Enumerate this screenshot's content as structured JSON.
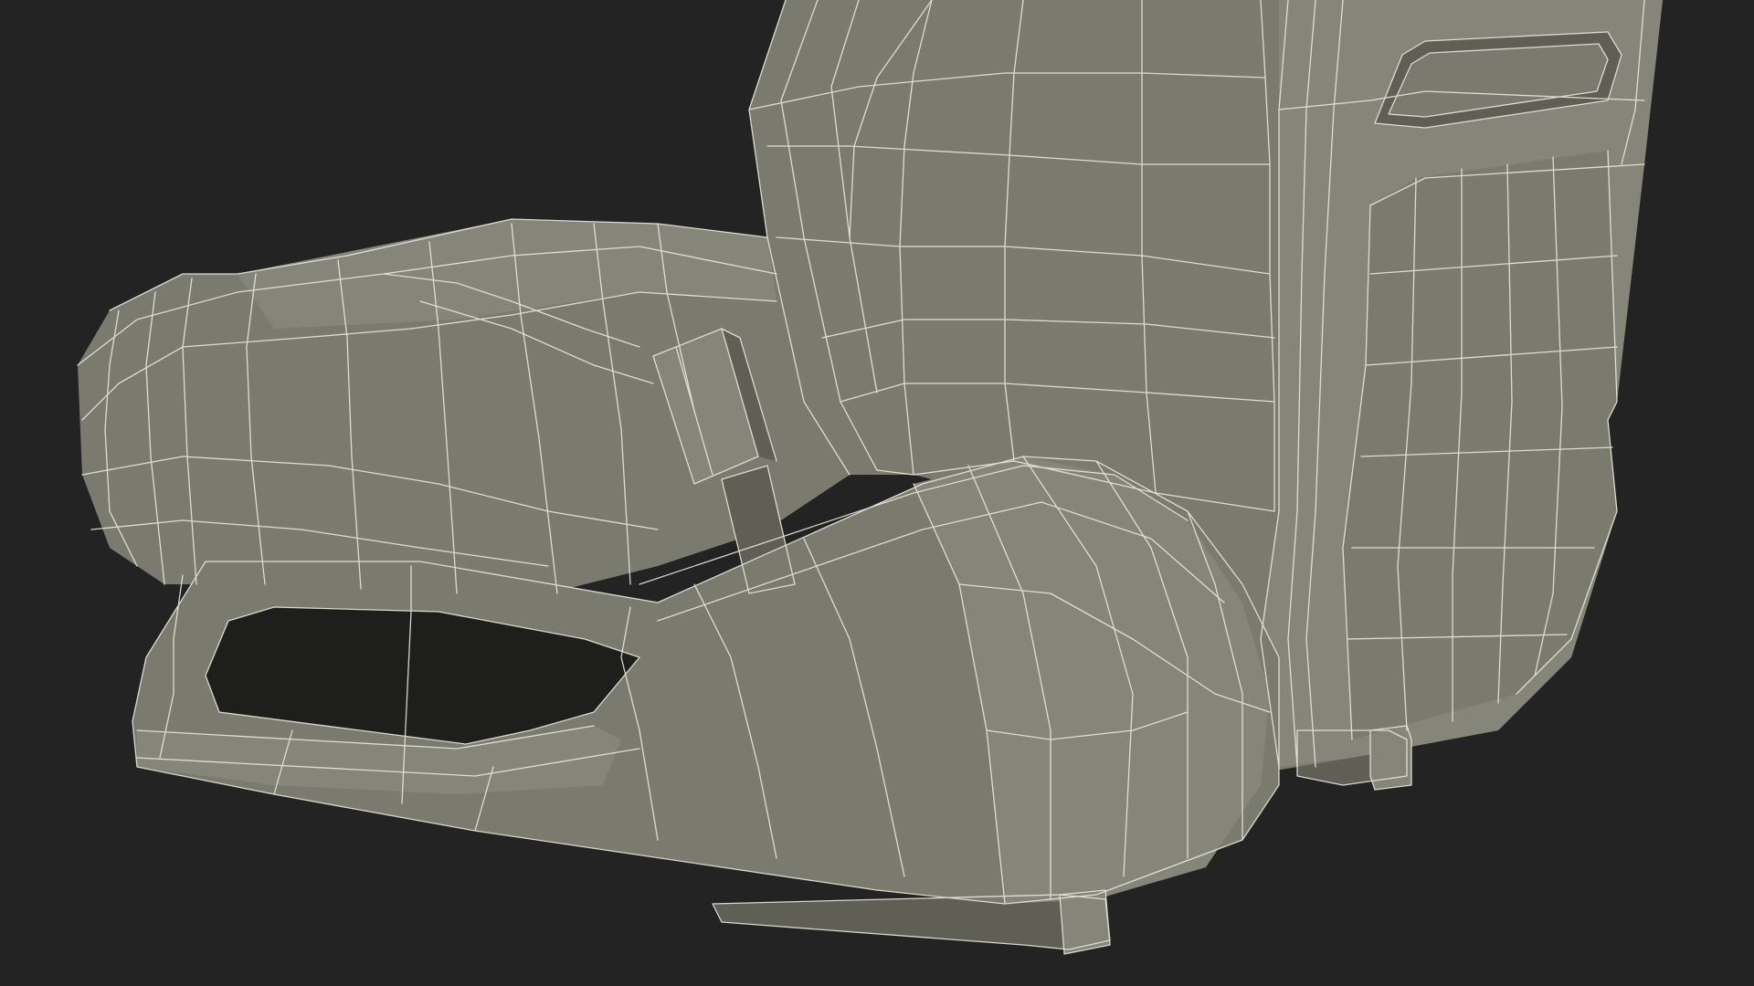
{
  "scene": {
    "subject": "car-seat-wireframe-render",
    "colors": {
      "background": "#232323",
      "surface": "#7a7a6e",
      "surface_light": "#85857a",
      "surface_dark": "#5f5f55",
      "shadow": "#1e1e1c",
      "wire": "#e8e8da"
    }
  }
}
